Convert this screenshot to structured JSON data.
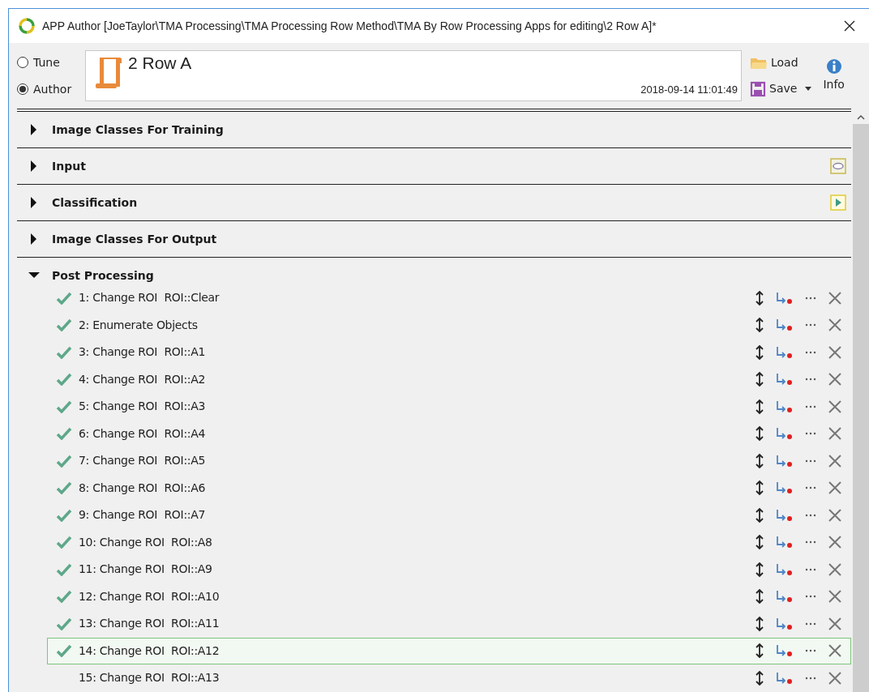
{
  "window": {
    "title": "APP Author [JoeTaylor\\TMA Processing\\TMA Processing Row Method\\TMA By Row Processing Apps for editing\\2 Row A]*"
  },
  "modes": [
    {
      "label": "Tune",
      "selected": false
    },
    {
      "label": "Author",
      "selected": true
    }
  ],
  "app": {
    "name": "2 Row A",
    "timestamp": "2018-09-14 11:01:49"
  },
  "actions": {
    "load": "Load",
    "save": "Save",
    "info": "Info"
  },
  "sections": [
    {
      "title": "Image Classes For Training",
      "expanded": false,
      "kind": "plain"
    },
    {
      "title": "Input",
      "expanded": false,
      "kind": "shape"
    },
    {
      "title": "Classification",
      "expanded": false,
      "kind": "play"
    },
    {
      "title": "Image Classes For Output",
      "expanded": false,
      "kind": "plain"
    },
    {
      "title": "Post Processing",
      "expanded": true,
      "kind": "plain"
    }
  ],
  "steps": [
    {
      "label": "1: Change ROI  ROI::Clear",
      "checked": true,
      "selected": false
    },
    {
      "label": "2: Enumerate Objects",
      "checked": true,
      "selected": false
    },
    {
      "label": "3: Change ROI  ROI::A1",
      "checked": true,
      "selected": false
    },
    {
      "label": "4: Change ROI  ROI::A2",
      "checked": true,
      "selected": false
    },
    {
      "label": "5: Change ROI  ROI::A3",
      "checked": true,
      "selected": false
    },
    {
      "label": "6: Change ROI  ROI::A4",
      "checked": true,
      "selected": false
    },
    {
      "label": "7: Change ROI  ROI::A5",
      "checked": true,
      "selected": false
    },
    {
      "label": "8: Change ROI  ROI::A6",
      "checked": true,
      "selected": false
    },
    {
      "label": "9: Change ROI  ROI::A7",
      "checked": true,
      "selected": false
    },
    {
      "label": "10: Change ROI  ROI::A8",
      "checked": true,
      "selected": false
    },
    {
      "label": "11: Change ROI  ROI::A9",
      "checked": true,
      "selected": false
    },
    {
      "label": "12: Change ROI  ROI::A10",
      "checked": true,
      "selected": false
    },
    {
      "label": "13: Change ROI  ROI::A11",
      "checked": true,
      "selected": false
    },
    {
      "label": "14: Change ROI  ROI::A12",
      "checked": true,
      "selected": true
    },
    {
      "label": "15: Change ROI  ROI::A13",
      "checked": false,
      "selected": false
    }
  ]
}
